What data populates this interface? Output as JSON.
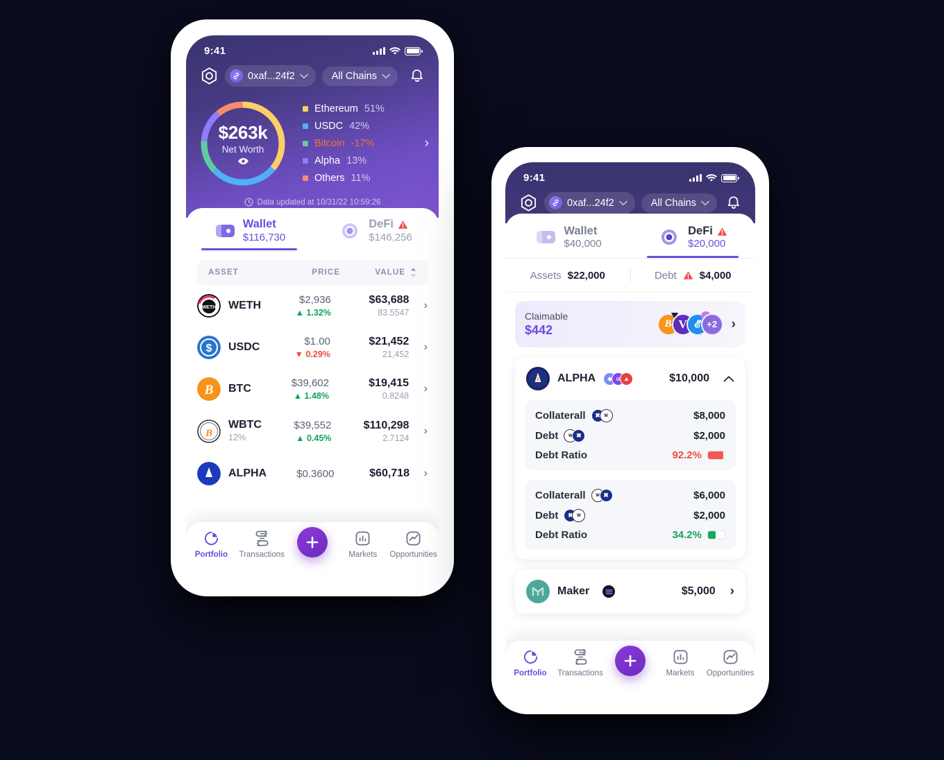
{
  "theme": {
    "bg": "#0a0d1f",
    "accent": "#6c4ddb",
    "header_purple": "#45397f",
    "green": "#12a35f",
    "red": "#ef4b46",
    "orange": "#f2703f"
  },
  "phone_one": {
    "status_bar": {
      "time": "9:41",
      "signal_icon": "signal-bars-icon",
      "wifi_icon": "wifi-icon",
      "battery_icon": "battery-icon"
    },
    "header": {
      "logo_icon": "app-hexagon-logo-icon",
      "wallet_chip": {
        "label": "0xaf...24f2",
        "badge_icon": "link-chain-icon",
        "chevron_icon": "chevron-down-icon"
      },
      "chain_chip": {
        "label": "All Chains",
        "chevron_icon": "chevron-down-icon"
      },
      "bell_icon": "notification-bell-icon"
    },
    "net_worth": {
      "value": "$263k",
      "label": "Net Worth",
      "eye_icon": "eye-visibility-icon",
      "arrow_icon": "chevron-right-icon"
    },
    "updated": {
      "clock_icon": "clock-icon",
      "text": "Data updated at 10/31/22 10:59:26"
    },
    "tabs": [
      {
        "name": "Wallet",
        "value": "$116,730",
        "icon": "wallet-icon",
        "active": true,
        "warning": false
      },
      {
        "name": "DeFi",
        "value": "$146,256",
        "icon": "defi-target-icon",
        "active": false,
        "warning": true,
        "warning_icon": "warning-triangle-icon"
      }
    ],
    "table": {
      "headers": {
        "asset": "ASSET",
        "price": "PRICE",
        "value": "VALUE",
        "sort_icon": "sort-updown-icon"
      },
      "rows": [
        {
          "symbol": "WETH",
          "sub": "",
          "icon": "weth-coin-icon",
          "price": "$2,936",
          "change": "1.32%",
          "direction": "up",
          "value": "$63,688",
          "qty": "83.5547",
          "chevron_icon": "chevron-right-icon"
        },
        {
          "symbol": "USDC",
          "sub": "",
          "icon": "usdc-coin-icon",
          "price": "$1.00",
          "change": "0.29%",
          "direction": "down",
          "value": "$21,452",
          "qty": "21,452",
          "chevron_icon": "chevron-right-icon"
        },
        {
          "symbol": "BTC",
          "sub": "",
          "icon": "btc-coin-icon",
          "price": "$39,602",
          "change": "1.48%",
          "direction": "up",
          "value": "$19,415",
          "qty": "0.8248",
          "chevron_icon": "chevron-right-icon"
        },
        {
          "symbol": "WBTC",
          "sub": "12%",
          "icon": "wbtc-coin-icon",
          "price": "$39,552",
          "change": "0.45%",
          "direction": "up",
          "value": "$110,298",
          "qty": "2.7124",
          "chevron_icon": "chevron-right-icon"
        },
        {
          "symbol": "ALPHA",
          "sub": "",
          "icon": "alpha-coin-icon",
          "price": "$0.3600",
          "change": "",
          "direction": "",
          "value": "$60,718",
          "qty": "",
          "chevron_icon": "chevron-right-icon"
        }
      ]
    },
    "bottom_nav": [
      {
        "label": "Portfolio",
        "icon": "pie-chart-icon",
        "active": true
      },
      {
        "label": "Transactions",
        "icon": "swap-arrows-icon",
        "active": false
      },
      {
        "label": "",
        "icon": "plus-fab-icon",
        "active": false
      },
      {
        "label": "Markets",
        "icon": "bar-chart-icon",
        "active": false
      },
      {
        "label": "Opportunities",
        "icon": "trend-line-icon",
        "active": false
      }
    ]
  },
  "phone_two": {
    "status_bar": {
      "time": "9:41",
      "signal_icon": "signal-bars-icon",
      "wifi_icon": "wifi-icon",
      "battery_icon": "battery-icon"
    },
    "header": {
      "logo_icon": "app-hexagon-logo-icon",
      "wallet_chip": {
        "label": "0xaf...24f2",
        "badge_icon": "link-chain-icon",
        "chevron_icon": "chevron-down-icon"
      },
      "chain_chip": {
        "label": "All Chains",
        "chevron_icon": "chevron-down-icon"
      },
      "bell_icon": "notification-bell-icon"
    },
    "tabs": [
      {
        "name": "Wallet",
        "value": "$40,000",
        "icon": "wallet-icon",
        "active": false,
        "warning": false
      },
      {
        "name": "DeFi",
        "value": "$20,000",
        "icon": "defi-target-icon",
        "active": true,
        "warning": true,
        "warning_icon": "warning-triangle-icon"
      }
    ],
    "summary": {
      "assets_label": "Assets",
      "assets_value": "$22,000",
      "debt_label": "Debt",
      "debt_value": "$4,000",
      "debt_warning_icon": "warning-triangle-icon"
    },
    "claimable": {
      "label": "Claimable",
      "amount": "$442",
      "extra_count": "+2",
      "token_icons": [
        "btc-token-icon",
        "venus-token-icon",
        "synthetix-token-icon"
      ],
      "chevron_icon": "chevron-right-icon"
    },
    "protocols": [
      {
        "name": "ALPHA",
        "icon": "alpha-protocol-icon",
        "chain_icons": [
          "ethereum-chain-icon",
          "polygon-chain-icon",
          "avalanche-chain-icon"
        ],
        "amount": "$10,000",
        "collapse_icon": "chevron-up-icon",
        "positions": [
          {
            "collateral_label": "Collaterall",
            "collateral_value": "$8,000",
            "collateral_icons": [
              "xrp-token-icon",
              "weth-token-icon"
            ],
            "debt_label": "Debt",
            "debt_value": "$2,000",
            "debt_icons": [
              "weth-token-icon",
              "xrp-token-icon"
            ],
            "ratio_label": "Debt Ratio",
            "ratio_value": "92.2%",
            "ratio_state": "danger",
            "ratio_fill": 92
          },
          {
            "collateral_label": "Collaterall",
            "collateral_value": "$6,000",
            "collateral_icons": [
              "weth-token-icon",
              "xrp-token-icon"
            ],
            "debt_label": "Debt",
            "debt_value": "$2,000",
            "debt_icons": [
              "xrp-token-icon",
              "weth-token-icon"
            ],
            "ratio_label": "Debt Ratio",
            "ratio_value": "34.2%",
            "ratio_state": "safe",
            "ratio_fill": 42
          }
        ]
      }
    ],
    "maker": {
      "name": "Maker",
      "icon": "maker-protocol-icon",
      "chain_icon": "dark-chain-icon",
      "amount": "$5,000",
      "chevron_icon": "chevron-right-icon"
    },
    "bottom_nav": [
      {
        "label": "Portfolio",
        "icon": "pie-chart-icon",
        "active": true
      },
      {
        "label": "Transactions",
        "icon": "swap-arrows-icon",
        "active": false
      },
      {
        "label": "",
        "icon": "plus-fab-icon",
        "active": false
      },
      {
        "label": "Markets",
        "icon": "bar-chart-icon",
        "active": false
      },
      {
        "label": "Opportunities",
        "icon": "trend-line-icon",
        "active": false
      }
    ]
  },
  "chart_data": {
    "type": "pie",
    "title": "Net Worth",
    "center_value": "$263k",
    "labels": [
      "Ethereum",
      "USDC",
      "Bitcoin",
      "Alpha",
      "Others"
    ],
    "values": [
      51,
      42,
      -17,
      13,
      11
    ],
    "display_percents": [
      "51%",
      "42%",
      "-17%",
      "13%",
      "11%"
    ],
    "colors": [
      "#fbcf66",
      "#4fb0f5",
      "#5fcca0",
      "#8e7cf8",
      "#f88a6b"
    ],
    "legend_position": "right",
    "donut": true,
    "arc_fractions": [
      0.36,
      0.27,
      0.13,
      0.13,
      0.11
    ]
  }
}
